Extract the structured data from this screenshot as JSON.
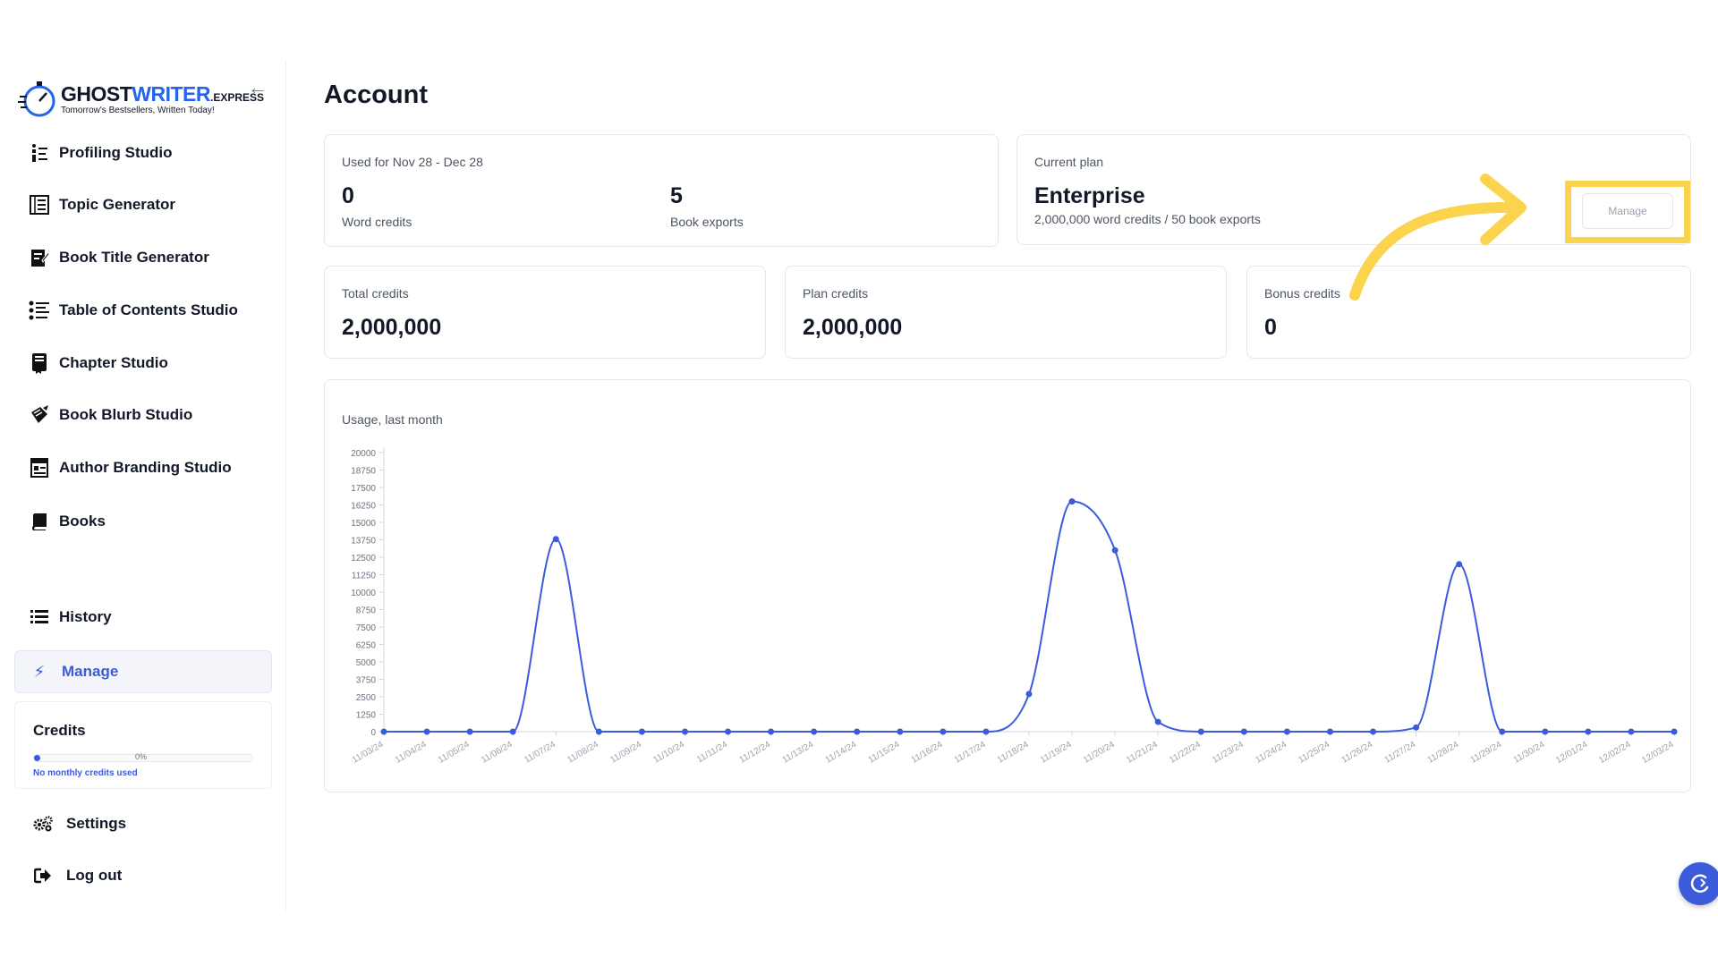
{
  "brand": {
    "name_part1": "GHOST",
    "name_part2": "WRITER",
    "name_ext": ".EXPRESS",
    "tagline": "Tomorrow's Bestsellers, Written Today!"
  },
  "sidebar": {
    "items": [
      {
        "label": "Profiling Studio",
        "icon": "profiling-icon"
      },
      {
        "label": "Topic Generator",
        "icon": "topic-icon"
      },
      {
        "label": "Book Title Generator",
        "icon": "title-icon"
      },
      {
        "label": "Table of Contents Studio",
        "icon": "toc-icon"
      },
      {
        "label": "Chapter Studio",
        "icon": "chapter-icon"
      },
      {
        "label": "Book Blurb Studio",
        "icon": "blurb-icon"
      },
      {
        "label": "Author Branding Studio",
        "icon": "branding-icon"
      },
      {
        "label": "Books",
        "icon": "books-icon"
      }
    ],
    "history": {
      "label": "History",
      "icon": "list-icon"
    },
    "manage": {
      "label": "Manage",
      "icon": "bolt-icon"
    },
    "credits": {
      "title": "Credits",
      "percent_label": "0%",
      "fraction": 0.0,
      "note": "No monthly credits used"
    },
    "settings": {
      "label": "Settings",
      "icon": "gears-icon"
    },
    "logout": {
      "label": "Log out",
      "icon": "logout-icon"
    }
  },
  "page": {
    "title": "Account"
  },
  "usage_card": {
    "period": "Used for Nov 28 - Dec 28",
    "word_credits_value": "0",
    "word_credits_label": "Word credits",
    "book_exports_value": "5",
    "book_exports_label": "Book exports"
  },
  "plan_card": {
    "caption": "Current plan",
    "name": "Enterprise",
    "details": "2,000,000 word credits / 50 book exports",
    "manage_label": "Manage"
  },
  "totals": {
    "total_caption": "Total credits",
    "total_value": "2,000,000",
    "plan_caption": "Plan credits",
    "plan_value": "2,000,000",
    "bonus_caption": "Bonus credits",
    "bonus_value": "0"
  },
  "colors": {
    "accent": "#3b5bdb",
    "highlight": "#fcd34d",
    "line": "#3b5bdb"
  },
  "chart_data": {
    "type": "line",
    "title": "Usage, last month",
    "ylim": [
      0,
      20000
    ],
    "yticks": [
      0,
      1250,
      2500,
      3750,
      5000,
      6250,
      7500,
      8750,
      10000,
      11250,
      12500,
      13750,
      15000,
      16250,
      17500,
      18750,
      20000
    ],
    "grid": false,
    "x": [
      "11/03/24",
      "11/04/24",
      "11/05/24",
      "11/06/24",
      "11/07/24",
      "11/08/24",
      "11/09/24",
      "11/10/24",
      "11/11/24",
      "11/12/24",
      "11/13/24",
      "11/14/24",
      "11/15/24",
      "11/16/24",
      "11/17/24",
      "11/18/24",
      "11/19/24",
      "11/20/24",
      "11/21/24",
      "11/22/24",
      "11/23/24",
      "11/24/24",
      "11/25/24",
      "11/26/24",
      "11/27/24",
      "11/28/24",
      "11/29/24",
      "11/30/24",
      "12/01/24",
      "12/02/24",
      "12/03/24"
    ],
    "series": [
      {
        "values": [
          0,
          0,
          0,
          0,
          13800,
          0,
          0,
          0,
          0,
          0,
          0,
          0,
          0,
          0,
          0,
          2700,
          16500,
          13000,
          700,
          0,
          0,
          0,
          0,
          0,
          300,
          12000,
          0,
          0,
          0,
          0,
          0
        ]
      }
    ]
  }
}
